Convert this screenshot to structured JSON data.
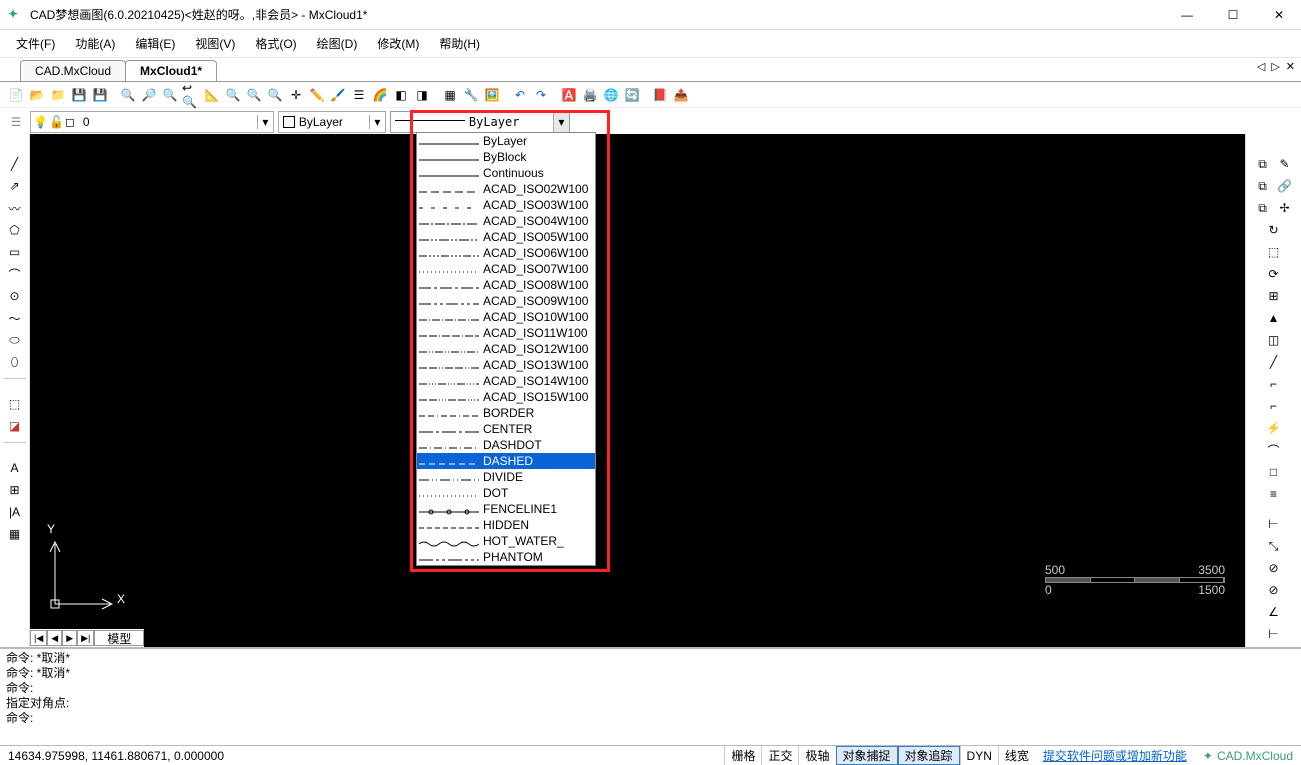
{
  "window": {
    "title": "CAD梦想画图(6.0.20210425)<姓赵的呀。,非会员> - MxCloud1*"
  },
  "menu": {
    "file": "文件(F)",
    "func": "功能(A)",
    "edit": "编辑(E)",
    "view": "视图(V)",
    "format": "格式(O)",
    "draw": "绘图(D)",
    "modify": "修改(M)",
    "help": "帮助(H)"
  },
  "tabs": {
    "t1": "CAD.MxCloud",
    "t2": "MxCloud1*"
  },
  "layer_combo": {
    "value": "0"
  },
  "color_combo": {
    "value": "ByLayer"
  },
  "linetype_combo": {
    "value": "ByLayer"
  },
  "linetypes": {
    "items": [
      "ByLayer",
      "ByBlock",
      "Continuous",
      "ACAD_ISO02W100",
      "ACAD_ISO03W100",
      "ACAD_ISO04W100",
      "ACAD_ISO05W100",
      "ACAD_ISO06W100",
      "ACAD_ISO07W100",
      "ACAD_ISO08W100",
      "ACAD_ISO09W100",
      "ACAD_ISO10W100",
      "ACAD_ISO11W100",
      "ACAD_ISO12W100",
      "ACAD_ISO13W100",
      "ACAD_ISO14W100",
      "ACAD_ISO15W100",
      "BORDER",
      "CENTER",
      "DASHDOT",
      "DASHED",
      "DIVIDE",
      "DOT",
      "FENCELINE1",
      "HIDDEN",
      "HOT_WATER_",
      "PHANTOM"
    ],
    "selected": "DASHED"
  },
  "ruler": {
    "v1": "500",
    "v2": "3500",
    "v3": "0",
    "v4": "1500"
  },
  "model_tab": {
    "label": "模型"
  },
  "cmd": {
    "l1": "命令:  *取消*",
    "l2": "命令:  *取消*",
    "l3": "命令:",
    "l4": "指定对角点:",
    "l5": "命令:"
  },
  "status": {
    "coords": "14634.975998,  11461.880671,  0.000000",
    "grid": "栅格",
    "ortho": "正交",
    "polar": "极轴",
    "osnap": "对象捕捉",
    "otrack": "对象追踪",
    "dyn": "DYN",
    "lweight": "线宽",
    "link": "提交软件问题或增加新功能",
    "brand": "CAD.MxCloud"
  },
  "ucs": {
    "y": "Y",
    "x": "X"
  }
}
